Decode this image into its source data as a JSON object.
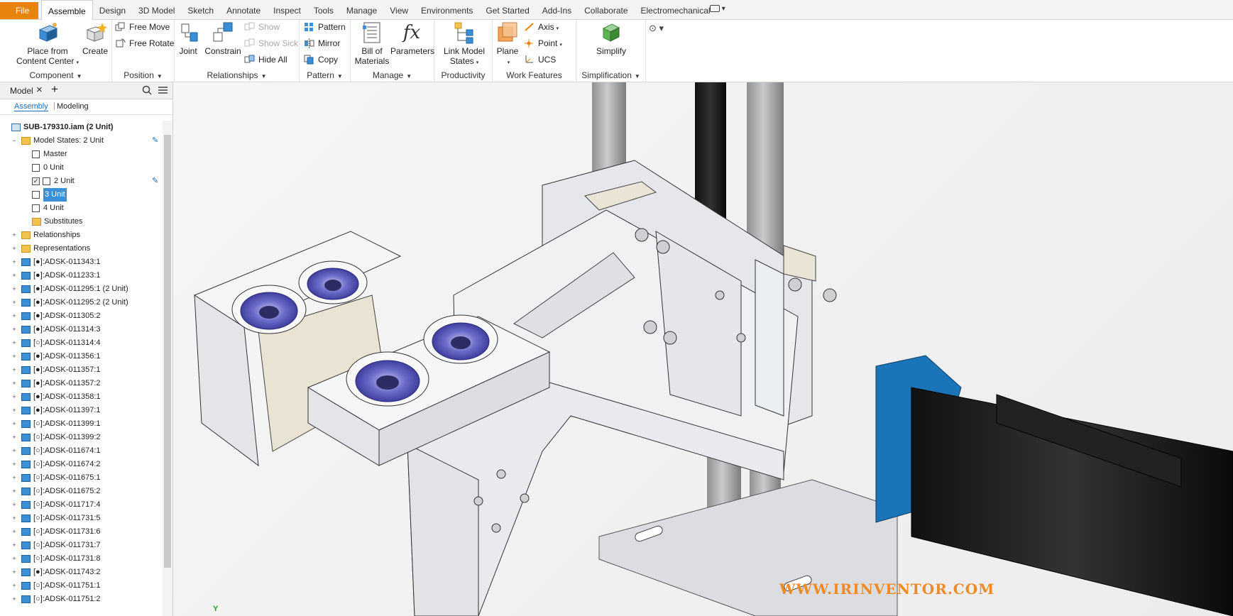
{
  "file_tab": "File",
  "tabs": [
    "Assemble",
    "Design",
    "3D Model",
    "Sketch",
    "Annotate",
    "Inspect",
    "Tools",
    "Manage",
    "View",
    "Environments",
    "Get Started",
    "Add-Ins",
    "Collaborate",
    "Electromechanical"
  ],
  "active_tab": "Assemble",
  "ribbon": {
    "component": {
      "title": "Component",
      "place_from": "Place from",
      "content_center": "Content Center",
      "create": "Create"
    },
    "position": {
      "title": "Position",
      "free_move": "Free Move",
      "free_rotate": "Free Rotate"
    },
    "relationships": {
      "title": "Relationships",
      "joint": "Joint",
      "constrain": "Constrain",
      "show": "Show",
      "show_sick": "Show Sick",
      "hide_all": "Hide All"
    },
    "pattern": {
      "title": "Pattern",
      "pattern": "Pattern",
      "mirror": "Mirror",
      "copy": "Copy"
    },
    "manage": {
      "title": "Manage",
      "bill_of": "Bill of",
      "materials": "Materials",
      "parameters": "Parameters"
    },
    "productivity": {
      "title": "Productivity",
      "link_model": "Link Model",
      "states": "States"
    },
    "work_features": {
      "title": "Work Features",
      "plane": "Plane",
      "axis": "Axis",
      "point": "Point",
      "ucs": "UCS"
    },
    "simplification": {
      "title": "Simplification",
      "simplify": "Simplify"
    }
  },
  "browser": {
    "title": "Model",
    "tab_assembly": "Assembly",
    "tab_modeling": "Modeling",
    "root": "SUB-179310.iam (2 Unit)",
    "model_states": "Model States: 2 Unit",
    "states": [
      "Master",
      "0 Unit",
      "2 Unit",
      "3 Unit",
      "4 Unit"
    ],
    "substitutes": "Substitutes",
    "relationships": "Relationships",
    "representations": "Representations",
    "parts": [
      "[●]:ADSK-011343:1",
      "[●]:ADSK-011233:1",
      "[●]:ADSK-011295:1 (2 Unit)",
      "[●]:ADSK-011295:2 (2 Unit)",
      "[●]:ADSK-011305:2",
      "[●]:ADSK-011314:3",
      "[○]:ADSK-011314:4",
      "[●]:ADSK-011356:1",
      "[●]:ADSK-011357:1",
      "[●]:ADSK-011357:2",
      "[●]:ADSK-011358:1",
      "[●]:ADSK-011397:1",
      "[○]:ADSK-011399:1",
      "[○]:ADSK-011399:2",
      "[○]:ADSK-011674:1",
      "[○]:ADSK-011674:2",
      "[○]:ADSK-011675:1",
      "[○]:ADSK-011675:2",
      "[○]:ADSK-011717:4",
      "[○]:ADSK-011731:5",
      "[○]:ADSK-011731:6",
      "[○]:ADSK-011731:7",
      "[○]:ADSK-011731:8",
      "[●]:ADSK-011743:2",
      "[○]:ADSK-011751:1",
      "[○]:ADSK-011751:2"
    ]
  },
  "viewport": {
    "watermark": "WWW.IRINVENTOR.COM",
    "axis_label": "Y"
  },
  "colors": {
    "file_button": "#e8830d",
    "selection": "#3b8fd6",
    "motor_blue": "#1a75b8",
    "watermark": "#f08a24"
  }
}
